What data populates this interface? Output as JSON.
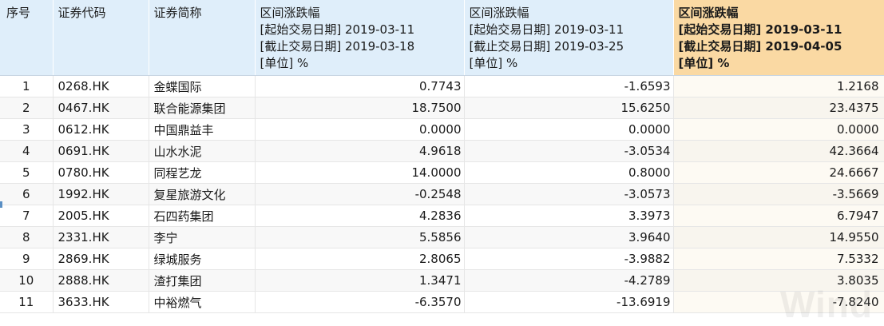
{
  "columns": {
    "index": "序号",
    "code": "证券代码",
    "name": "证券简称",
    "period1": [
      "区间涨跌幅",
      "[起始交易日期] 2019-03-11",
      "[截止交易日期] 2019-03-18",
      "[单位] %"
    ],
    "period2": [
      "区间涨跌幅",
      "[起始交易日期] 2019-03-11",
      "[截止交易日期] 2019-03-25",
      "[单位] %"
    ],
    "period3": [
      "区间涨跌幅",
      "[起始交易日期] 2019-03-11",
      "[截止交易日期] 2019-04-05",
      "[单位] %"
    ]
  },
  "rows": [
    {
      "no": "1",
      "code": "0268.HK",
      "name": "金蝶国际",
      "p1": "0.7743",
      "p2": "-1.6593",
      "p3": "1.2168"
    },
    {
      "no": "2",
      "code": "0467.HK",
      "name": "联合能源集团",
      "p1": "18.7500",
      "p2": "15.6250",
      "p3": "23.4375"
    },
    {
      "no": "3",
      "code": "0612.HK",
      "name": "中国鼎益丰",
      "p1": "0.0000",
      "p2": "0.0000",
      "p3": "0.0000"
    },
    {
      "no": "4",
      "code": "0691.HK",
      "name": "山水水泥",
      "p1": "4.9618",
      "p2": "-3.0534",
      "p3": "42.3664"
    },
    {
      "no": "5",
      "code": "0780.HK",
      "name": "同程艺龙",
      "p1": "14.0000",
      "p2": "0.8000",
      "p3": "24.6667"
    },
    {
      "no": "6",
      "code": "1992.HK",
      "name": "复星旅游文化",
      "p1": "-0.2548",
      "p2": "-3.0573",
      "p3": "-3.5669"
    },
    {
      "no": "7",
      "code": "2005.HK",
      "name": "石四药集团",
      "p1": "4.2836",
      "p2": "3.3973",
      "p3": "6.7947"
    },
    {
      "no": "8",
      "code": "2331.HK",
      "name": "李宁",
      "p1": "5.5856",
      "p2": "3.9640",
      "p3": "14.9550"
    },
    {
      "no": "9",
      "code": "2869.HK",
      "name": "绿城服务",
      "p1": "2.8065",
      "p2": "-3.9882",
      "p3": "7.5332"
    },
    {
      "no": "10",
      "code": "2888.HK",
      "name": "渣打集团",
      "p1": "1.3471",
      "p2": "-4.2789",
      "p3": "3.8035"
    },
    {
      "no": "11",
      "code": "3633.HK",
      "name": "中裕燃气",
      "p1": "-6.3570",
      "p2": "-13.6919",
      "p3": "-7.8240"
    }
  ],
  "watermark": "Wind",
  "colors": {
    "header_bg": "#dfeefa",
    "highlight_header_bg": "#fad9a3"
  }
}
